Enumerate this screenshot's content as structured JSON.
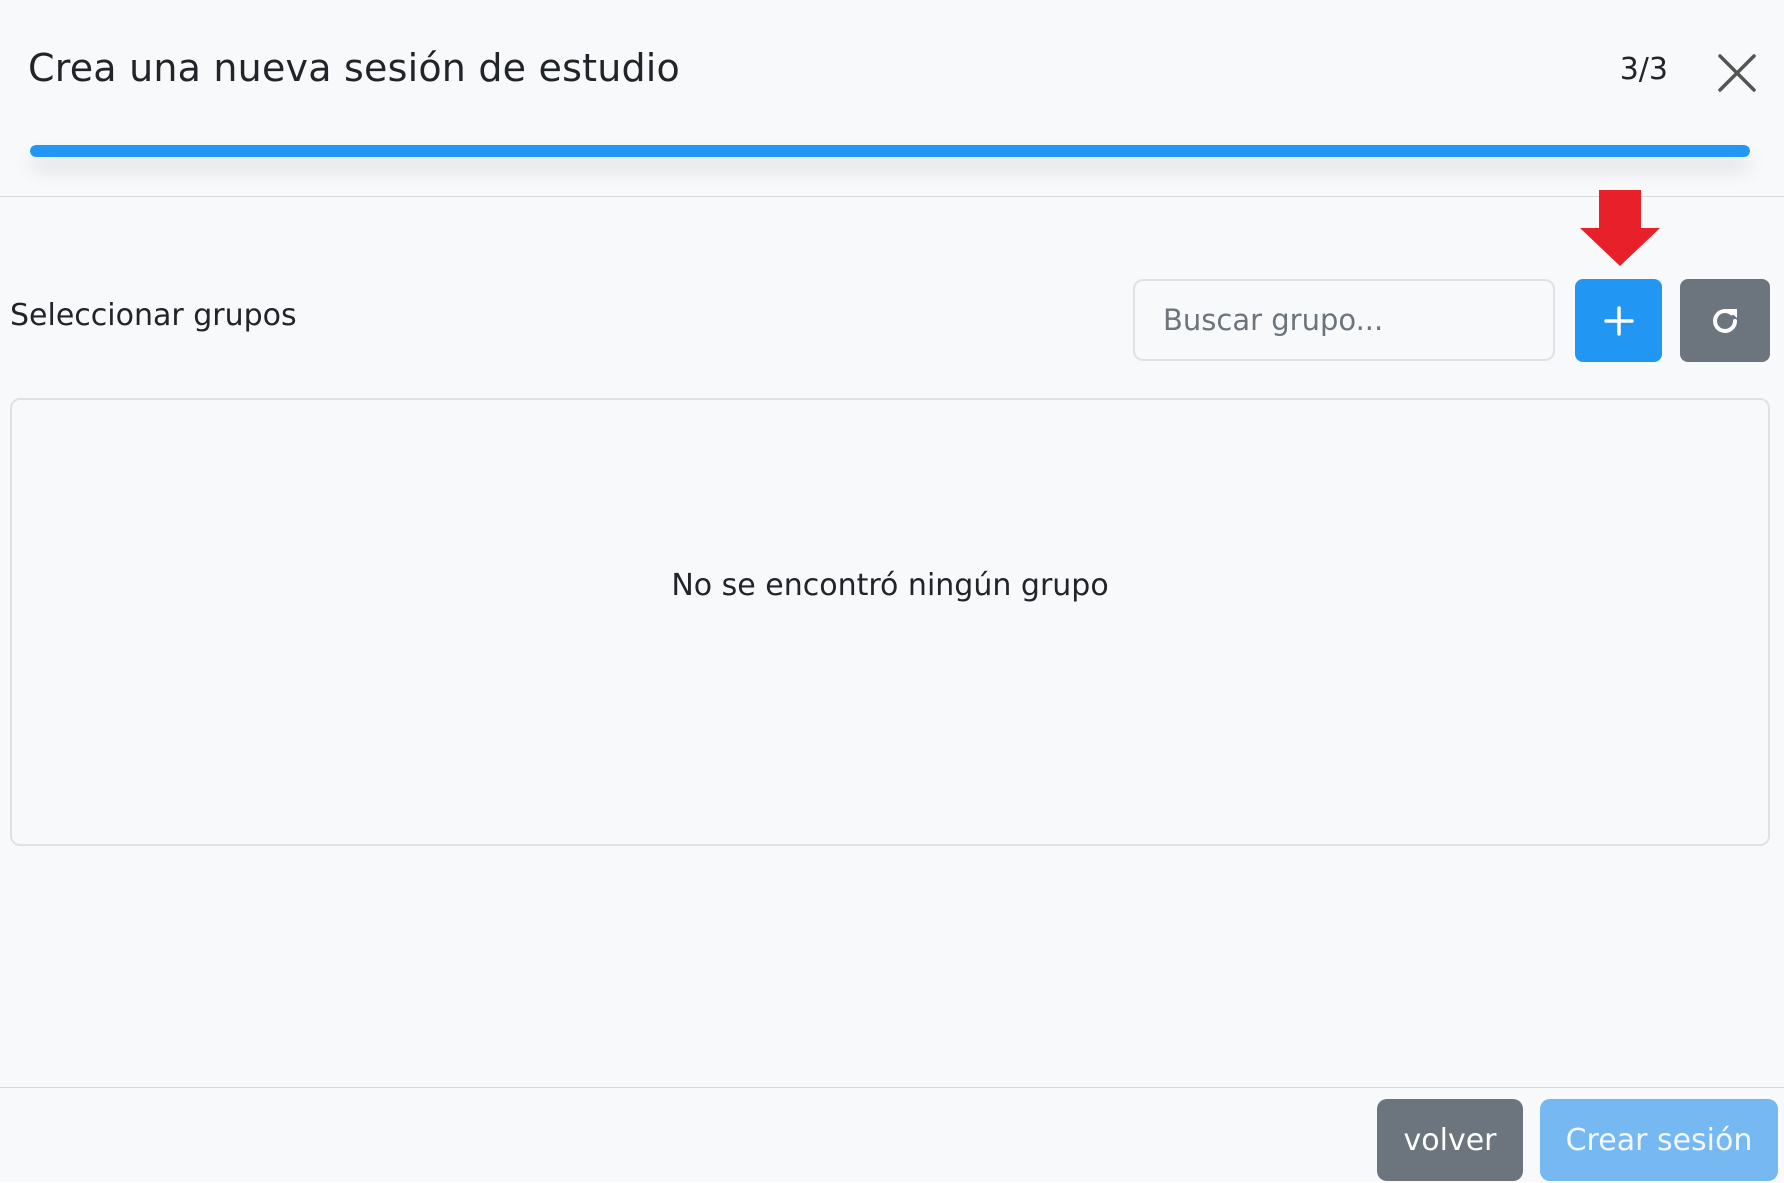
{
  "header": {
    "title": "Crea una nueva sesión de estudio",
    "step_counter": "3/3",
    "close_icon": "close-icon",
    "progress_fraction": 1.0
  },
  "groups": {
    "label": "Seleccionar grupos",
    "search_placeholder": "Buscar grupo...",
    "search_value": "",
    "add_icon": "plus-icon",
    "refresh_icon": "refresh-icon",
    "empty_message": "No se encontró ningún grupo"
  },
  "annotation": {
    "icon": "red-arrow-down-icon",
    "color": "#e8202a"
  },
  "footer": {
    "back_label": "volver",
    "create_label": "Crear sesión",
    "create_disabled": true
  },
  "colors": {
    "primary": "#2196f3",
    "secondary": "#6c757d",
    "primary_disabled": "#75b8f2",
    "background": "#f8f9fa"
  }
}
